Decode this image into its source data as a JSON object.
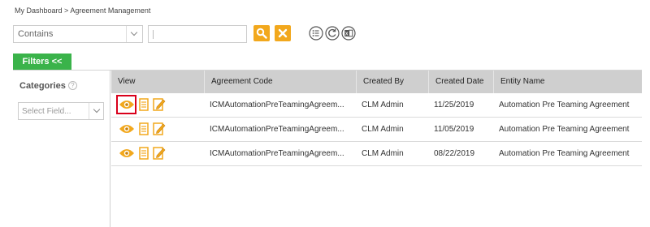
{
  "breadcrumb": {
    "home": "My Dashboard",
    "separator": ">",
    "current": "Agreement Management"
  },
  "search": {
    "operator": "Contains",
    "value": ""
  },
  "filters": {
    "button_label": "Filters <<"
  },
  "sidebar": {
    "categories_label": "Categories",
    "field_placeholder": "Select Field..."
  },
  "grid": {
    "columns": [
      "View",
      "Agreement Code",
      "Created By",
      "Created Date",
      "Entity Name"
    ],
    "rows": [
      {
        "code": "ICMAutomationPreTeamingAgreem...",
        "created_by": "CLM Admin",
        "created_date": "11/25/2019",
        "entity": "Automation Pre Teaming Agreement"
      },
      {
        "code": "ICMAutomationPreTeamingAgreem...",
        "created_by": "CLM Admin",
        "created_date": "11/05/2019",
        "entity": "Automation Pre Teaming Agreement"
      },
      {
        "code": "ICMAutomationPreTeamingAgreem...",
        "created_by": "CLM Admin",
        "created_date": "08/22/2019",
        "entity": "Automation Pre Teaming Agreement"
      }
    ]
  },
  "colors": {
    "accent": "#f2a81d",
    "filters_green": "#3ab34a",
    "header_gray": "#cfcfcf",
    "highlight_red": "#d9001b"
  },
  "icons": [
    "chevron-down-icon",
    "search-icon",
    "clear-icon",
    "list-icon",
    "refresh-icon",
    "export-icon",
    "help-icon",
    "eye-icon",
    "document-icon",
    "edit-icon"
  ]
}
